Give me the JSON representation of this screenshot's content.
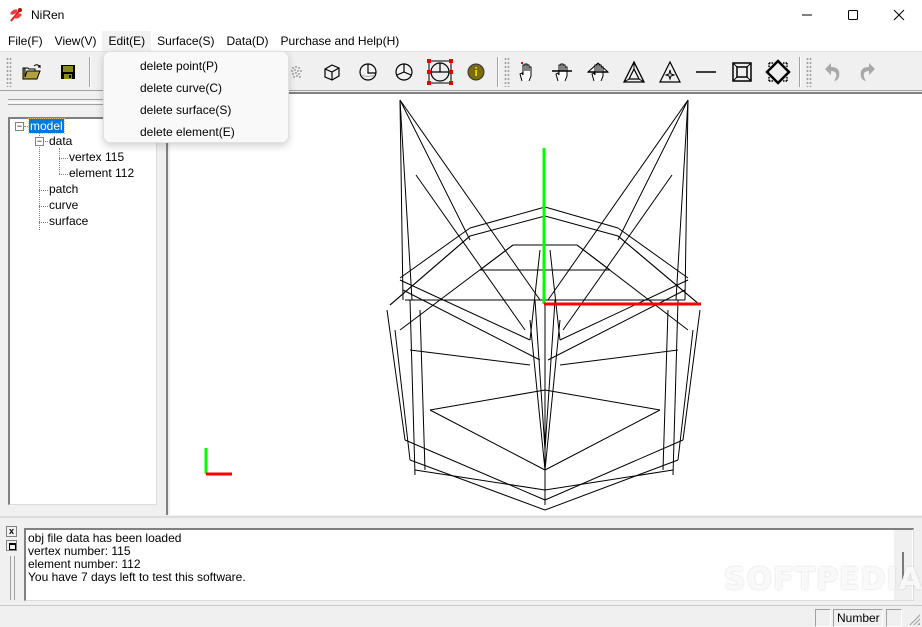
{
  "window": {
    "title": "NiRen",
    "app_icon": "dragonfly-icon",
    "controls": [
      "minimize",
      "maximize",
      "close"
    ]
  },
  "menubar": {
    "items": [
      {
        "label": "File(F)"
      },
      {
        "label": "View(V)"
      },
      {
        "label": "Edit(E)",
        "active": true
      },
      {
        "label": "Surface(S)"
      },
      {
        "label": "Data(D)"
      },
      {
        "label": "Purchase and  Help(H)"
      }
    ]
  },
  "edit_menu": {
    "items": [
      {
        "label": "delete point(P)"
      },
      {
        "label": "delete curve(C)"
      },
      {
        "label": "delete surface(S)"
      },
      {
        "label": "delete element(E)"
      }
    ]
  },
  "toolbar": {
    "groups": [
      [
        "open-folder-icon",
        "save-disk-icon"
      ],
      [
        "point-cloud-icon",
        "cube-icon",
        "sphere-icon",
        "sphere-sections-icon",
        "bounding-box-select-icon",
        "info-icon"
      ],
      [
        "hand-point-icon",
        "hand-line-icon",
        "hand-triangle-icon",
        "triangle-icon",
        "triangle-star-icon",
        "line-icon",
        "square-frame-icon",
        "diamond-select-icon"
      ],
      [
        "undo-icon",
        "redo-icon"
      ]
    ]
  },
  "tree": {
    "root": {
      "label": "model",
      "selected": true,
      "expanded": true
    },
    "data": {
      "label": "data",
      "expanded": true
    },
    "vertex": {
      "label": "vertex 115"
    },
    "element": {
      "label": "element 112"
    },
    "patch": {
      "label": "patch"
    },
    "curve": {
      "label": "curve"
    },
    "surface": {
      "label": "surface"
    }
  },
  "viewport": {
    "axis_colors": {
      "x": "#ff0000",
      "y": "#00ff00"
    },
    "wireframe_color": "#000000"
  },
  "output": {
    "lines": [
      "obj file data has been loaded",
      "vertex number: 115",
      "element number: 112",
      "You have 7 days left to test this software."
    ]
  },
  "watermark": "SOFTPEDIA",
  "statusbar": {
    "cells": [
      "",
      "Number",
      ""
    ]
  }
}
